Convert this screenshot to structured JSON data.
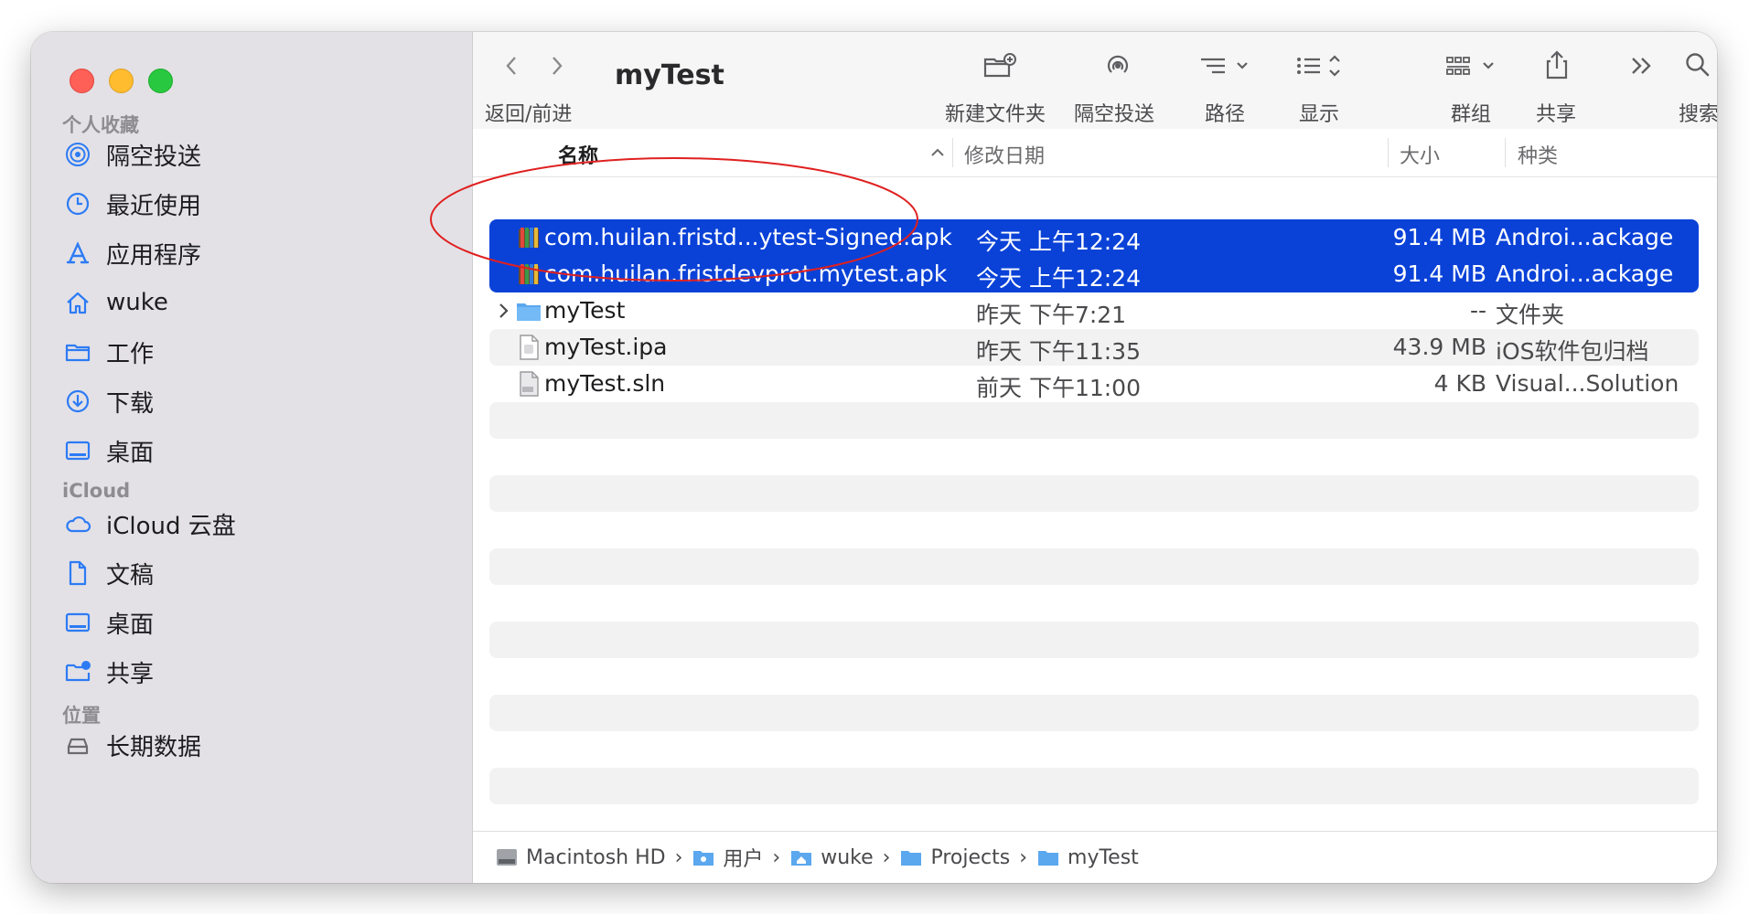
{
  "window": {
    "title": "myTest"
  },
  "sidebar": {
    "sections": [
      {
        "label": "个人收藏",
        "items": [
          {
            "label": "隔空投送",
            "icon": "airdrop-icon"
          },
          {
            "label": "最近使用",
            "icon": "clock-icon"
          },
          {
            "label": "应用程序",
            "icon": "applications-icon"
          },
          {
            "label": "wuke",
            "icon": "home-icon"
          },
          {
            "label": "工作",
            "icon": "folder-icon"
          },
          {
            "label": "下载",
            "icon": "download-icon"
          },
          {
            "label": "桌面",
            "icon": "desktop-icon"
          }
        ]
      },
      {
        "label": "iCloud",
        "items": [
          {
            "label": "iCloud 云盘",
            "icon": "cloud-icon"
          },
          {
            "label": "文稿",
            "icon": "document-icon"
          },
          {
            "label": "桌面",
            "icon": "desktop-icon"
          },
          {
            "label": "共享",
            "icon": "shared-folder-icon"
          }
        ]
      },
      {
        "label": "位置",
        "items": [
          {
            "label": "长期数据",
            "icon": "drive-icon"
          }
        ]
      }
    ]
  },
  "toolbar": {
    "back_forward_label": "返回/前进",
    "new_folder_label": "新建文件夹",
    "airdrop_label": "隔空投送",
    "path_label": "路径",
    "view_label": "显示",
    "group_label": "群组",
    "share_label": "共享",
    "search_label": "搜索"
  },
  "columns": {
    "name": "名称",
    "date": "修改日期",
    "size": "大小",
    "kind": "种类"
  },
  "files": [
    {
      "name": "com.huilan.fristd...ytest-Signed.apk",
      "date": "今天 上午12:24",
      "size": "91.4 MB",
      "kind": "Androi...ackage",
      "icon": "apk-icon",
      "selected": true
    },
    {
      "name": "com.huilan.fristdevprot.mytest.apk",
      "date": "今天 上午12:24",
      "size": "91.4 MB",
      "kind": "Androi...ackage",
      "icon": "apk-icon",
      "selected": true
    },
    {
      "name": "myTest",
      "date": "昨天 下午7:21",
      "size": "--",
      "kind": "文件夹",
      "icon": "folder-icon",
      "selected": false
    },
    {
      "name": "myTest.ipa",
      "date": "昨天 下午11:35",
      "size": "43.9 MB",
      "kind": "iOS软件包归档",
      "icon": "ipa-file-icon",
      "selected": false
    },
    {
      "name": "myTest.sln",
      "date": "前天 下午11:00",
      "size": "4 KB",
      "kind": "Visual...Solution",
      "icon": "sln-file-icon",
      "selected": false
    }
  ],
  "pathbar": [
    "Macintosh HD",
    "用户",
    "wuke",
    "Projects",
    "myTest"
  ],
  "colors": {
    "selection": "#0a42d8",
    "annotation": "#e02020",
    "sidebar": "#e3e1e6"
  }
}
